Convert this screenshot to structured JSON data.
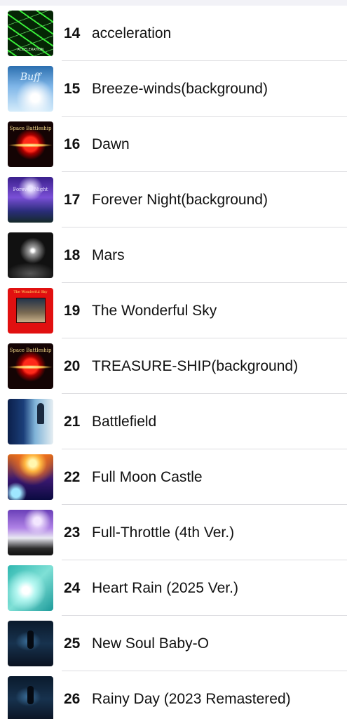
{
  "tracks": [
    {
      "number": "14",
      "title": "acceleration",
      "art_icon": "album-art-acceleration",
      "art_caption": "ACCELERATION"
    },
    {
      "number": "15",
      "title": "Breeze-winds(background)",
      "art_icon": "album-art-breeze",
      "art_caption": "Buff"
    },
    {
      "number": "16",
      "title": "Dawn",
      "art_icon": "album-art-space-battleship",
      "art_caption": "Space Battleship"
    },
    {
      "number": "17",
      "title": "Forever Night(background)",
      "art_icon": "album-art-forever-night",
      "art_caption": "Forever Night"
    },
    {
      "number": "18",
      "title": "Mars",
      "art_icon": "album-art-mars",
      "art_caption": ""
    },
    {
      "number": "19",
      "title": "The Wonderful Sky",
      "art_icon": "album-art-wonderful-sky",
      "art_caption": "The Wonderful Sky"
    },
    {
      "number": "20",
      "title": "TREASURE-SHIP(background)",
      "art_icon": "album-art-space-battleship",
      "art_caption": "Space Battleship"
    },
    {
      "number": "21",
      "title": "Battlefield",
      "art_icon": "album-art-battlefield",
      "art_caption": ""
    },
    {
      "number": "22",
      "title": "Full Moon Castle",
      "art_icon": "album-art-full-moon",
      "art_caption": ""
    },
    {
      "number": "23",
      "title": "Full-Throttle (4th Ver.)",
      "art_icon": "album-art-full-throttle",
      "art_caption": ""
    },
    {
      "number": "24",
      "title": "Heart Rain (2025 Ver.)",
      "art_icon": "album-art-heart-rain",
      "art_caption": ""
    },
    {
      "number": "25",
      "title": "New Soul Baby-O",
      "art_icon": "album-art-night-figure",
      "art_caption": ""
    },
    {
      "number": "26",
      "title": "Rainy Day (2023 Remastered)",
      "art_icon": "album-art-night-figure",
      "art_caption": ""
    }
  ],
  "colors": {
    "background": "#ffffff",
    "text": "#111111",
    "separator": "#dcdce0"
  }
}
